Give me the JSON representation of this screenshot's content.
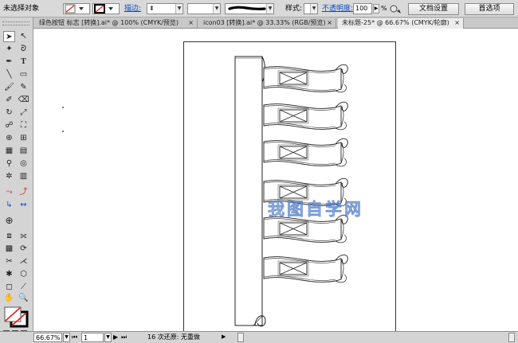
{
  "control_bar": {
    "selection_status": "未选择对象",
    "stroke_label": "描边:",
    "style_label": "样式:",
    "opacity_label": "不透明度:",
    "opacity_value": "100",
    "opacity_unit": "%",
    "document_setup_button": "文档设置",
    "preferences_button": "首选项"
  },
  "tabs": [
    {
      "label": "绿色按钮 标志 [转换].ai* @ 100% (CMYK/预览)",
      "active": false
    },
    {
      "label": "icon03 [转换].ai* @ 33.33% (RGB/预览)",
      "active": false
    },
    {
      "label": "未标题-25* @ 66.67% (CMYK/轮廓)",
      "active": true
    }
  ],
  "tab_close_glyph": "×",
  "canvas": {
    "watermark": "我图自学网",
    "banner_count": 6
  },
  "status_bar": {
    "zoom_value": "66.67%",
    "artboard_number": "1",
    "status_text": "16 次还原: 无重做"
  },
  "tools": {
    "icons": [
      "selection-tool-icon",
      "direct-selection-tool-icon",
      "magic-wand-tool-icon",
      "lasso-tool-icon",
      "pen-tool-icon",
      "type-tool-icon",
      "line-segment-tool-icon",
      "rectangle-tool-icon",
      "paintbrush-tool-icon",
      "pencil-tool-icon",
      "blob-brush-tool-icon",
      "eraser-tool-icon",
      "rotate-tool-icon",
      "scale-tool-icon",
      "warp-tool-icon",
      "free-transform-tool-icon",
      "shape-builder-tool-icon",
      "perspective-grid-tool-icon",
      "mesh-tool-icon",
      "gradient-tool-icon",
      "eyedropper-tool-icon",
      "blend-tool-icon",
      "symbol-sprayer-tool-icon",
      "column-graph-tool-icon",
      "artboard-tool-icon",
      "slice-tool-icon",
      "hand-tool-icon",
      "zoom-tool-icon"
    ],
    "colors": {
      "fill": "#ffffff",
      "stroke": "#000000",
      "none_slash": "#e02020"
    }
  },
  "colors": {
    "link_blue": "#0b48c8",
    "panel_gray": "#d4d4d4",
    "watermark_blue": "#4a78c8"
  }
}
